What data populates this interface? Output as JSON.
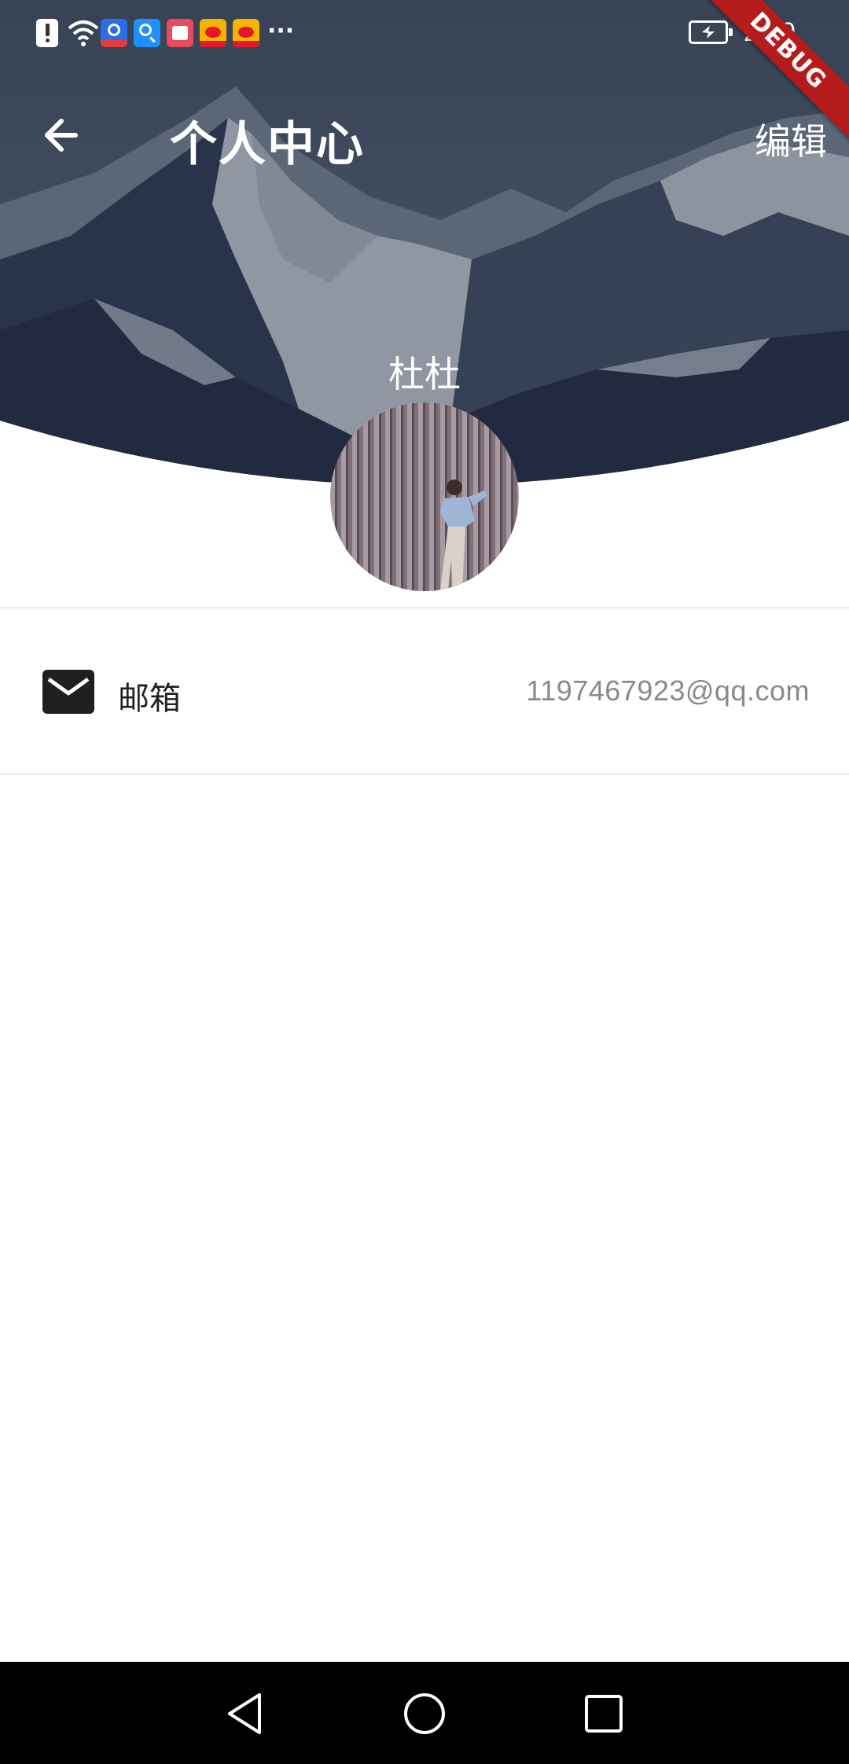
{
  "status_bar": {
    "time": "2:19",
    "more_indicator": "···",
    "icons": [
      "alert-icon",
      "wifi-icon",
      "baidu-icon",
      "search-app-icon",
      "notes-app-icon",
      "weibo-icon",
      "weibo-icon"
    ]
  },
  "debug_banner": "DEBUG",
  "app_bar": {
    "back_icon": "arrow-back-icon",
    "title": "个人中心",
    "edit_label": "编辑"
  },
  "profile": {
    "username": "杜杜"
  },
  "info_list": [
    {
      "icon": "mail-icon",
      "label": "邮箱",
      "value": "1197467923@qq.com"
    }
  ],
  "nav_bar": {
    "buttons": [
      "back-triangle-icon",
      "home-circle-icon",
      "recents-square-icon"
    ]
  },
  "colors": {
    "debug_red": "#b71c1c",
    "header_overlay": "#1c2434",
    "value_gray": "#8a8a8a"
  }
}
